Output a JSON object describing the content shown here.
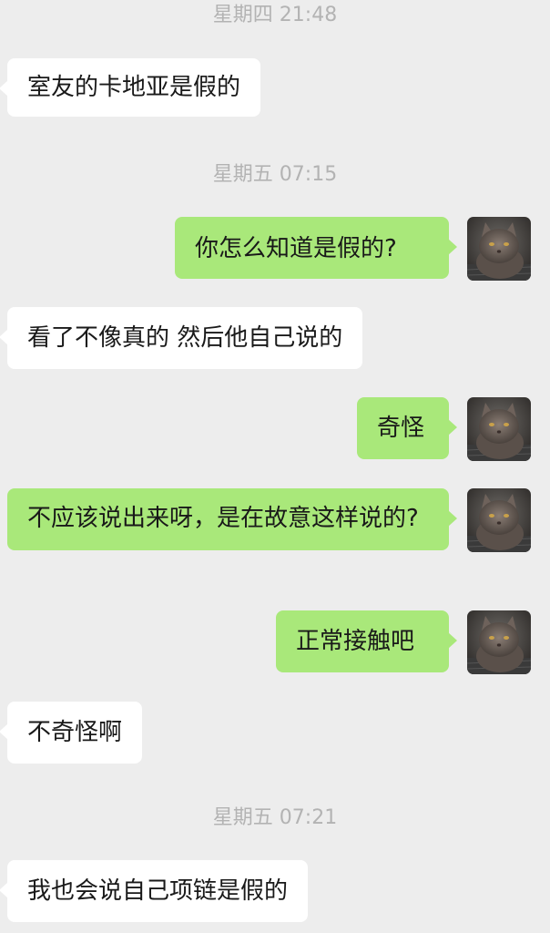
{
  "colors": {
    "background": "#ededed",
    "incoming_bubble": "#ffffff",
    "outgoing_bubble": "#a9e87a",
    "timestamp_text": "#b3b3b3",
    "message_text": "#191919"
  },
  "timestamps": [
    "星期四 21:48",
    "星期五 07:15",
    "星期五 07:21"
  ],
  "messages": [
    {
      "side": "left",
      "text": "室友的卡地亚是假的"
    },
    {
      "side": "right",
      "text": "你怎么知道是假的?",
      "avatar": "cat-avatar"
    },
    {
      "side": "left",
      "text": "看了不像真的 然后他自己说的"
    },
    {
      "side": "right",
      "text": "奇怪",
      "avatar": "cat-avatar"
    },
    {
      "side": "right",
      "text": "不应该说出来呀，是在故意这样说的?",
      "avatar": "cat-avatar"
    },
    {
      "side": "right",
      "text": "正常接触吧",
      "avatar": "cat-avatar"
    },
    {
      "side": "left",
      "text": "不奇怪啊"
    },
    {
      "side": "left",
      "text": "我也会说自己项链是假的"
    }
  ]
}
